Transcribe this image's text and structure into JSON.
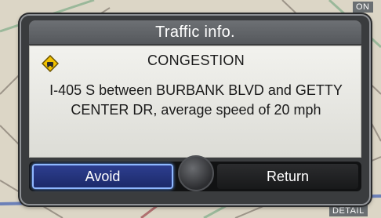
{
  "map": {
    "labels": [
      "ON",
      "DETAIL"
    ]
  },
  "dialog": {
    "title": "Traffic info.",
    "heading": "CONGESTION",
    "message": "I-405 S between BURBANK BLVD and GETTY CENTER DR, average speed of 20 mph",
    "icon": "traffic-warning-icon"
  },
  "buttons": {
    "avoid_label": "Avoid",
    "return_label": "Return"
  },
  "colors": {
    "selected_button": "#1c2a6a",
    "selected_border": "#8fb8ff",
    "warning_icon": "#f2c200"
  }
}
